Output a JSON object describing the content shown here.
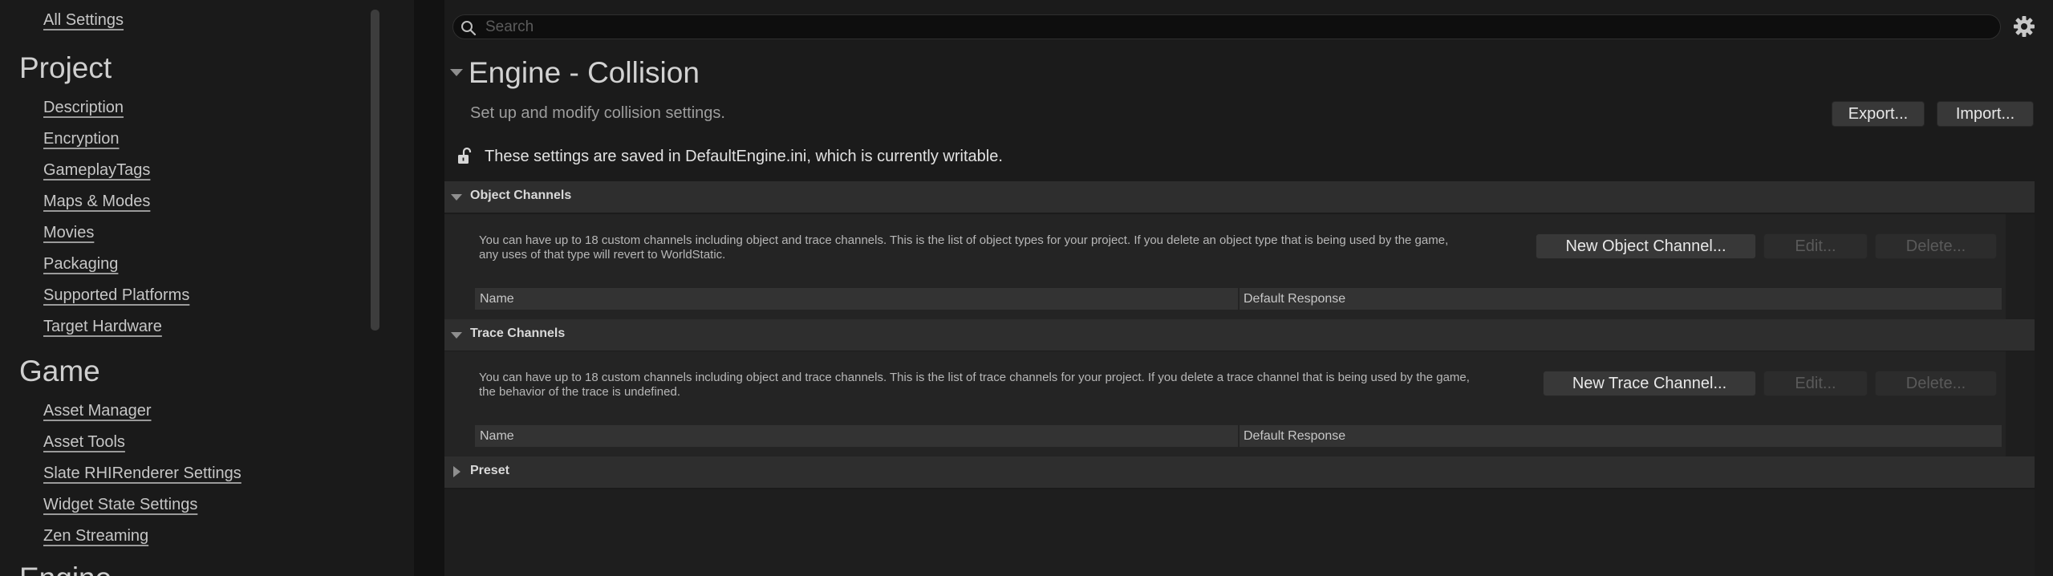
{
  "sidebar": {
    "all_settings": "All Settings",
    "categories": [
      {
        "title": "Project",
        "items": [
          "Description",
          "Encryption",
          "GameplayTags",
          "Maps & Modes",
          "Movies",
          "Packaging",
          "Supported Platforms",
          "Target Hardware"
        ]
      },
      {
        "title": "Game",
        "items": [
          "Asset Manager",
          "Asset Tools",
          "Slate RHIRenderer Settings",
          "Widget State Settings",
          "Zen Streaming"
        ]
      },
      {
        "title": "Engine",
        "items": []
      }
    ]
  },
  "search": {
    "placeholder": "Search",
    "value": ""
  },
  "icons": {
    "search": "search-icon",
    "settings": "gear-icon",
    "lock": "unlocked-lock-icon",
    "collapse": "triangle-down-icon",
    "expand": "triangle-right-icon"
  },
  "section": {
    "title": "Engine - Collision",
    "description": "Set up and modify collision settings.",
    "export_label": "Export...",
    "import_label": "Import...",
    "config_note": "These settings are saved in DefaultEngine.ini, which is currently writable."
  },
  "object_channels": {
    "header": "Object Channels",
    "description_line1": "You can have up to 18 custom channels including object and trace channels. This is the list of object types for your project. If you delete an object type that is being used by the game,",
    "description_line2": "any uses of that type will revert to WorldStatic.",
    "new_label": "New Object Channel...",
    "edit_label": "Edit...",
    "delete_label": "Delete...",
    "columns": [
      "Name",
      "Default Response"
    ]
  },
  "trace_channels": {
    "header": "Trace Channels",
    "description_line1": "You can have up to 18 custom channels including object and trace channels. This is the list of trace channels for your project. If you delete a trace channel that is being used by the game,",
    "description_line2": "the behavior of the trace is undefined.",
    "new_label": "New Trace Channel...",
    "edit_label": "Edit...",
    "delete_label": "Delete...",
    "columns": [
      "Name",
      "Default Response"
    ]
  },
  "preset": {
    "header": "Preset"
  },
  "colors": {
    "background": "#1b1b1b",
    "sidebar": "#1a1a1a",
    "header_bar": "#2e2e2e",
    "button": "#383838"
  }
}
